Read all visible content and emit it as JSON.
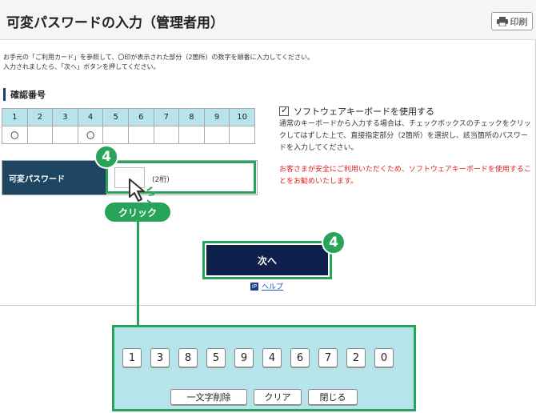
{
  "header": {
    "title": "可変パスワードの入力（管理者用）",
    "print_label": "印刷"
  },
  "instructions": {
    "line1": "お手元の「ご利用カード」を参照して、〇印が表示された部分（2箇所）の数字を順番に入力してください。",
    "line2": "入力されましたら、「次へ」ボタンを押してください。"
  },
  "confirm": {
    "heading": "確認番号",
    "columns": [
      "1",
      "2",
      "3",
      "4",
      "5",
      "6",
      "7",
      "8",
      "9",
      "10"
    ],
    "marks": [
      "〇",
      "",
      "",
      "〇",
      "",
      "",
      "",
      "",
      "",
      ""
    ]
  },
  "password": {
    "label": "可変パスワード",
    "value": "",
    "hint": "(2桁)"
  },
  "callouts": {
    "badge_left": "4",
    "badge_right": "4",
    "click_label": "クリック"
  },
  "software_kb": {
    "checkbox_label": "ソフトウェアキーボードを使用する",
    "checked": true,
    "description": "通常のキーボードから入力する場合は、チェックボックスのチェックをクリックしてはずした上で、直接指定部分（2箇所）を選択し、該当箇所のパスワードを入力してください。",
    "warning": "お客さまが安全にご利用いただくため、ソフトウェアキーボードを使用することをお勧めいたします。"
  },
  "next_button": "次へ",
  "help": {
    "icon_label": "iP",
    "label": "ヘルプ"
  },
  "keypad": {
    "keys": [
      "1",
      "3",
      "8",
      "5",
      "9",
      "4",
      "6",
      "7",
      "2",
      "0"
    ],
    "backspace": "一文字削除",
    "clear": "クリア",
    "close": "閉じる"
  },
  "colors": {
    "accent_green": "#27a35a",
    "navy": "#0f1f4b",
    "label_bg": "#1e4561",
    "header_cell": "#b8e3ea",
    "keypad_bg": "#b6e4ea",
    "warning_red": "#e02020"
  }
}
